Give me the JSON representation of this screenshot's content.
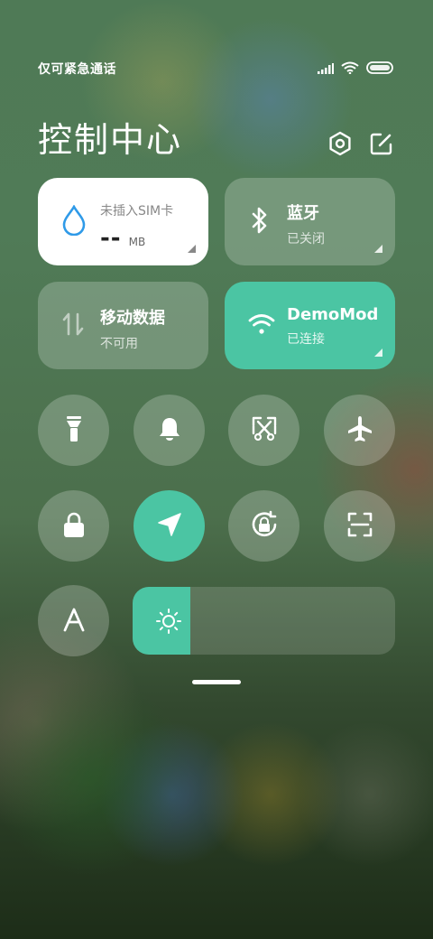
{
  "status_bar": {
    "carrier_text": "仅可紧急通话",
    "icons": [
      "signal-icon",
      "wifi-icon",
      "battery-icon"
    ]
  },
  "header": {
    "title": "控制中心",
    "settings_icon": "settings-hexagon-icon",
    "edit_icon": "edit-icon"
  },
  "tiles": {
    "data_usage": {
      "label": "未插入SIM卡",
      "value": "--",
      "unit": "MB",
      "icon": "water-drop-icon"
    },
    "bluetooth": {
      "label": "蓝牙",
      "status": "已关闭",
      "icon": "bluetooth-icon"
    },
    "mobile_data": {
      "label": "移动数据",
      "status": "不可用",
      "icon": "mobile-data-arrows-icon"
    },
    "wifi": {
      "label": "DemoMod",
      "status": "已连接",
      "icon": "wifi-icon"
    }
  },
  "toggles": [
    {
      "name": "flashlight",
      "icon": "flashlight-icon",
      "active": false
    },
    {
      "name": "ringer",
      "icon": "bell-icon",
      "active": false
    },
    {
      "name": "screenshot",
      "icon": "screenshot-scissors-icon",
      "active": false
    },
    {
      "name": "airplane-mode",
      "icon": "airplane-icon",
      "active": false
    },
    {
      "name": "lock-screen",
      "icon": "lock-icon",
      "active": false
    },
    {
      "name": "location",
      "icon": "location-arrow-icon",
      "active": true
    },
    {
      "name": "rotation-lock",
      "icon": "rotation-lock-icon",
      "active": false
    },
    {
      "name": "scanner",
      "icon": "scan-icon",
      "active": false
    },
    {
      "name": "auto-brightness",
      "icon": "letter-a-icon",
      "active": false
    }
  ],
  "brightness": {
    "level_fraction": 0.22,
    "icon": "sun-icon"
  },
  "colors": {
    "accent": "#4bc5a3",
    "tile_white": "#ffffff",
    "drop_blue": "#2f9ae8"
  }
}
